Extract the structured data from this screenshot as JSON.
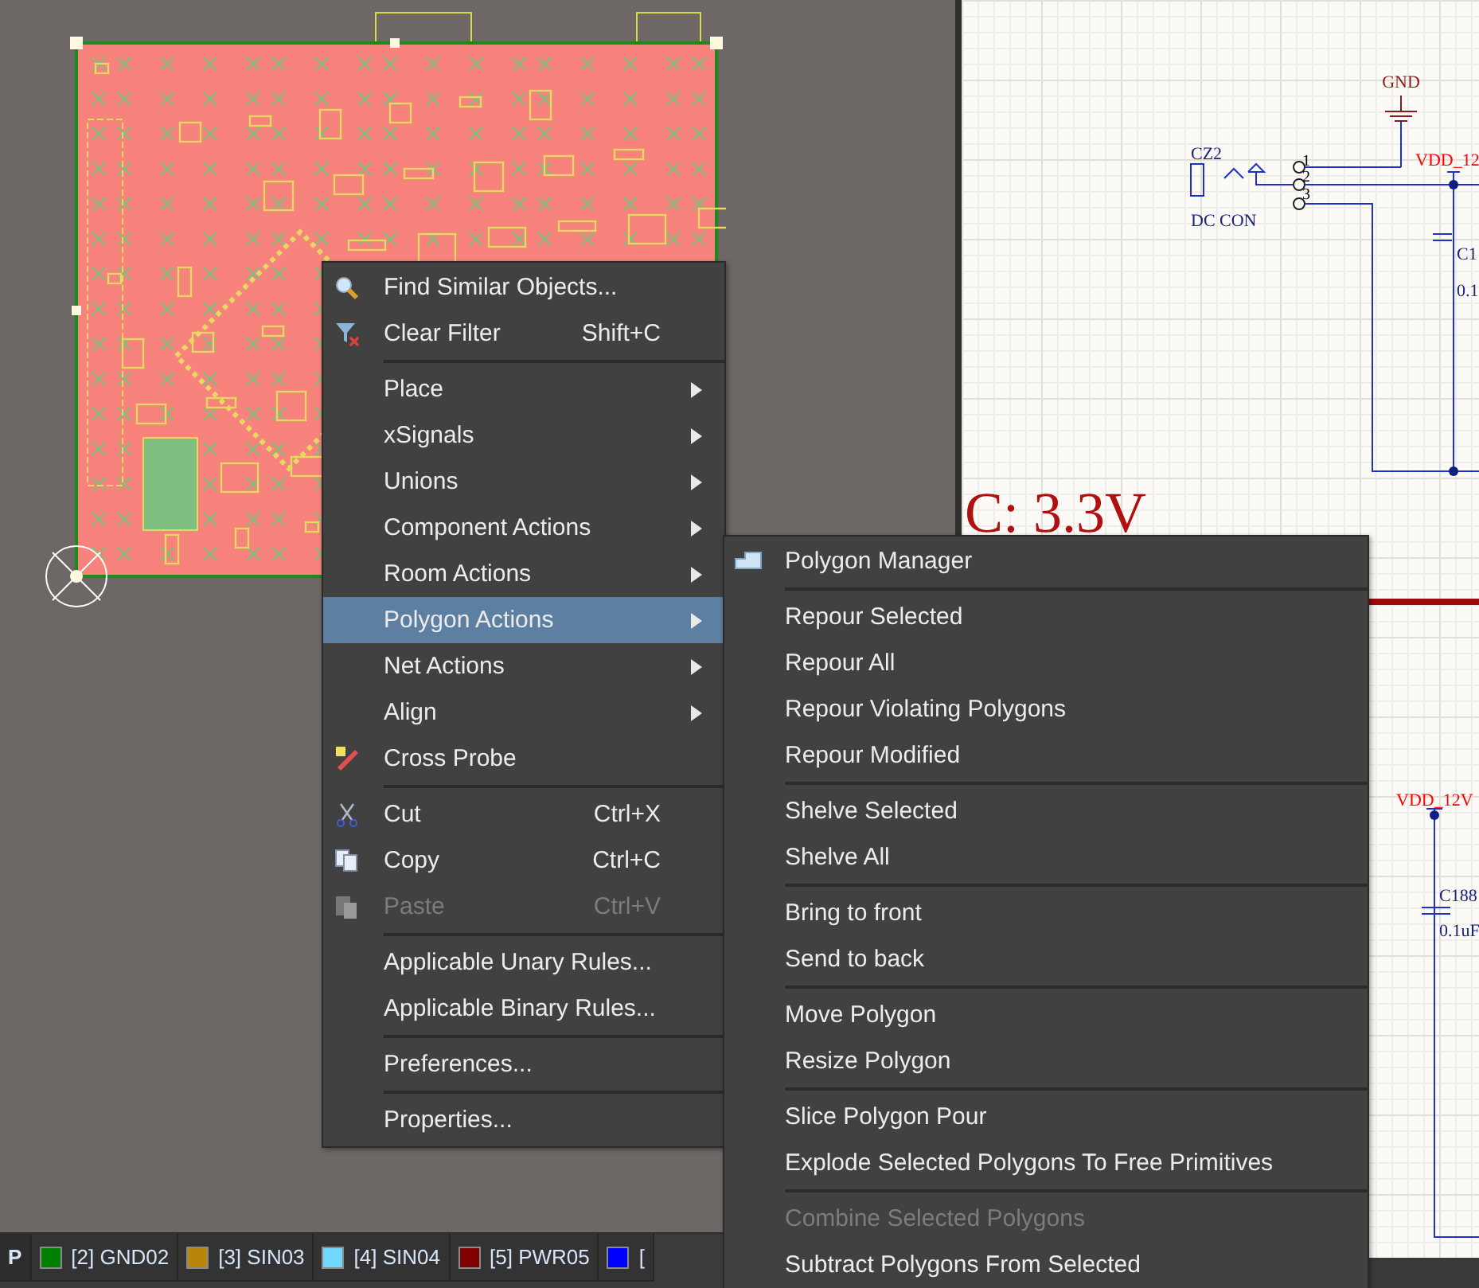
{
  "layer_tabs": [
    {
      "label": "P",
      "selected": true
    },
    {
      "label": "[2] GND02",
      "color": "#008000",
      "selected": false
    },
    {
      "label": "[3] SIN03",
      "color": "#b8860b",
      "selected": false
    },
    {
      "label": "[4] SIN04",
      "color": "#70d8ff",
      "selected": false
    },
    {
      "label": "[5] PWR05",
      "color": "#800000",
      "selected": false
    },
    {
      "label": "[",
      "color": "#0000ff",
      "selected": false
    }
  ],
  "schematic": {
    "labels": [
      {
        "kind": "power",
        "text": "GND"
      },
      {
        "kind": "ref",
        "text": "CZ2"
      },
      {
        "kind": "value",
        "text": "DC CON"
      },
      {
        "kind": "pin",
        "text": "1"
      },
      {
        "kind": "pin",
        "text": "2"
      },
      {
        "kind": "pin",
        "text": "3"
      },
      {
        "kind": "net",
        "text": "VDD_12"
      },
      {
        "kind": "ref",
        "text": "C1"
      },
      {
        "kind": "value",
        "text": "0.1"
      },
      {
        "kind": "title",
        "text": "C: 3.3V"
      },
      {
        "kind": "net",
        "text": "VDD_12V"
      },
      {
        "kind": "ref",
        "text": "C188"
      },
      {
        "kind": "value",
        "text": "0.1uF"
      }
    ]
  },
  "context_menu": {
    "items": [
      {
        "kind": "item",
        "label": "Find Similar Objects...",
        "selected": false,
        "disabled": false
      },
      {
        "kind": "item",
        "label": "Clear Filter",
        "shortcut": "Shift+C",
        "selected": false,
        "disabled": false
      },
      {
        "kind": "separator"
      },
      {
        "kind": "submenu",
        "label": "Place",
        "selected": false,
        "disabled": false
      },
      {
        "kind": "submenu",
        "label": "xSignals",
        "selected": false,
        "disabled": false
      },
      {
        "kind": "submenu",
        "label": "Unions",
        "selected": false,
        "disabled": false
      },
      {
        "kind": "submenu",
        "label": "Component Actions",
        "selected": false,
        "disabled": false
      },
      {
        "kind": "submenu",
        "label": "Room Actions",
        "selected": false,
        "disabled": false
      },
      {
        "kind": "submenu",
        "label": "Polygon Actions",
        "selected": true,
        "disabled": false
      },
      {
        "kind": "submenu",
        "label": "Net Actions",
        "selected": false,
        "disabled": false
      },
      {
        "kind": "submenu",
        "label": "Align",
        "selected": false,
        "disabled": false
      },
      {
        "kind": "item",
        "label": "Cross Probe",
        "selected": false,
        "disabled": false
      },
      {
        "kind": "separator"
      },
      {
        "kind": "item",
        "label": "Cut",
        "shortcut": "Ctrl+X",
        "selected": false,
        "disabled": false
      },
      {
        "kind": "item",
        "label": "Copy",
        "shortcut": "Ctrl+C",
        "selected": false,
        "disabled": false
      },
      {
        "kind": "item",
        "label": "Paste",
        "shortcut": "Ctrl+V",
        "selected": false,
        "disabled": true
      },
      {
        "kind": "separator"
      },
      {
        "kind": "item",
        "label": "Applicable Unary Rules...",
        "selected": false,
        "disabled": false
      },
      {
        "kind": "item",
        "label": "Applicable Binary Rules...",
        "selected": false,
        "disabled": false
      },
      {
        "kind": "separator"
      },
      {
        "kind": "item",
        "label": "Preferences...",
        "selected": false,
        "disabled": false
      },
      {
        "kind": "separator"
      },
      {
        "kind": "item",
        "label": "Properties...",
        "selected": false,
        "disabled": false
      }
    ]
  },
  "submenu": {
    "items": [
      {
        "kind": "item",
        "label": "Polygon Manager",
        "selected": false,
        "disabled": false
      },
      {
        "kind": "separator"
      },
      {
        "kind": "item",
        "label": "Repour Selected",
        "selected": false,
        "disabled": false
      },
      {
        "kind": "item",
        "label": "Repour All",
        "selected": false,
        "disabled": false
      },
      {
        "kind": "item",
        "label": "Repour Violating Polygons",
        "selected": false,
        "disabled": false
      },
      {
        "kind": "item",
        "label": "Repour Modified",
        "selected": false,
        "disabled": false
      },
      {
        "kind": "separator"
      },
      {
        "kind": "item",
        "label": "Shelve Selected",
        "selected": false,
        "disabled": false
      },
      {
        "kind": "item",
        "label": "Shelve All",
        "selected": false,
        "disabled": false
      },
      {
        "kind": "separator"
      },
      {
        "kind": "item",
        "label": "Bring to front",
        "selected": false,
        "disabled": false
      },
      {
        "kind": "item",
        "label": "Send to back",
        "selected": false,
        "disabled": false
      },
      {
        "kind": "separator"
      },
      {
        "kind": "item",
        "label": "Move Polygon",
        "selected": false,
        "disabled": false
      },
      {
        "kind": "item",
        "label": "Resize Polygon",
        "selected": false,
        "disabled": false
      },
      {
        "kind": "separator"
      },
      {
        "kind": "item",
        "label": "Slice Polygon Pour",
        "selected": false,
        "disabled": false
      },
      {
        "kind": "item",
        "label": "Explode Selected Polygons To Free Primitives",
        "selected": false,
        "disabled": false
      },
      {
        "kind": "separator"
      },
      {
        "kind": "item",
        "label": "Combine Selected Polygons",
        "selected": false,
        "disabled": true
      },
      {
        "kind": "item",
        "label": "Subtract Polygons From Selected",
        "selected": false,
        "disabled": false
      }
    ]
  }
}
